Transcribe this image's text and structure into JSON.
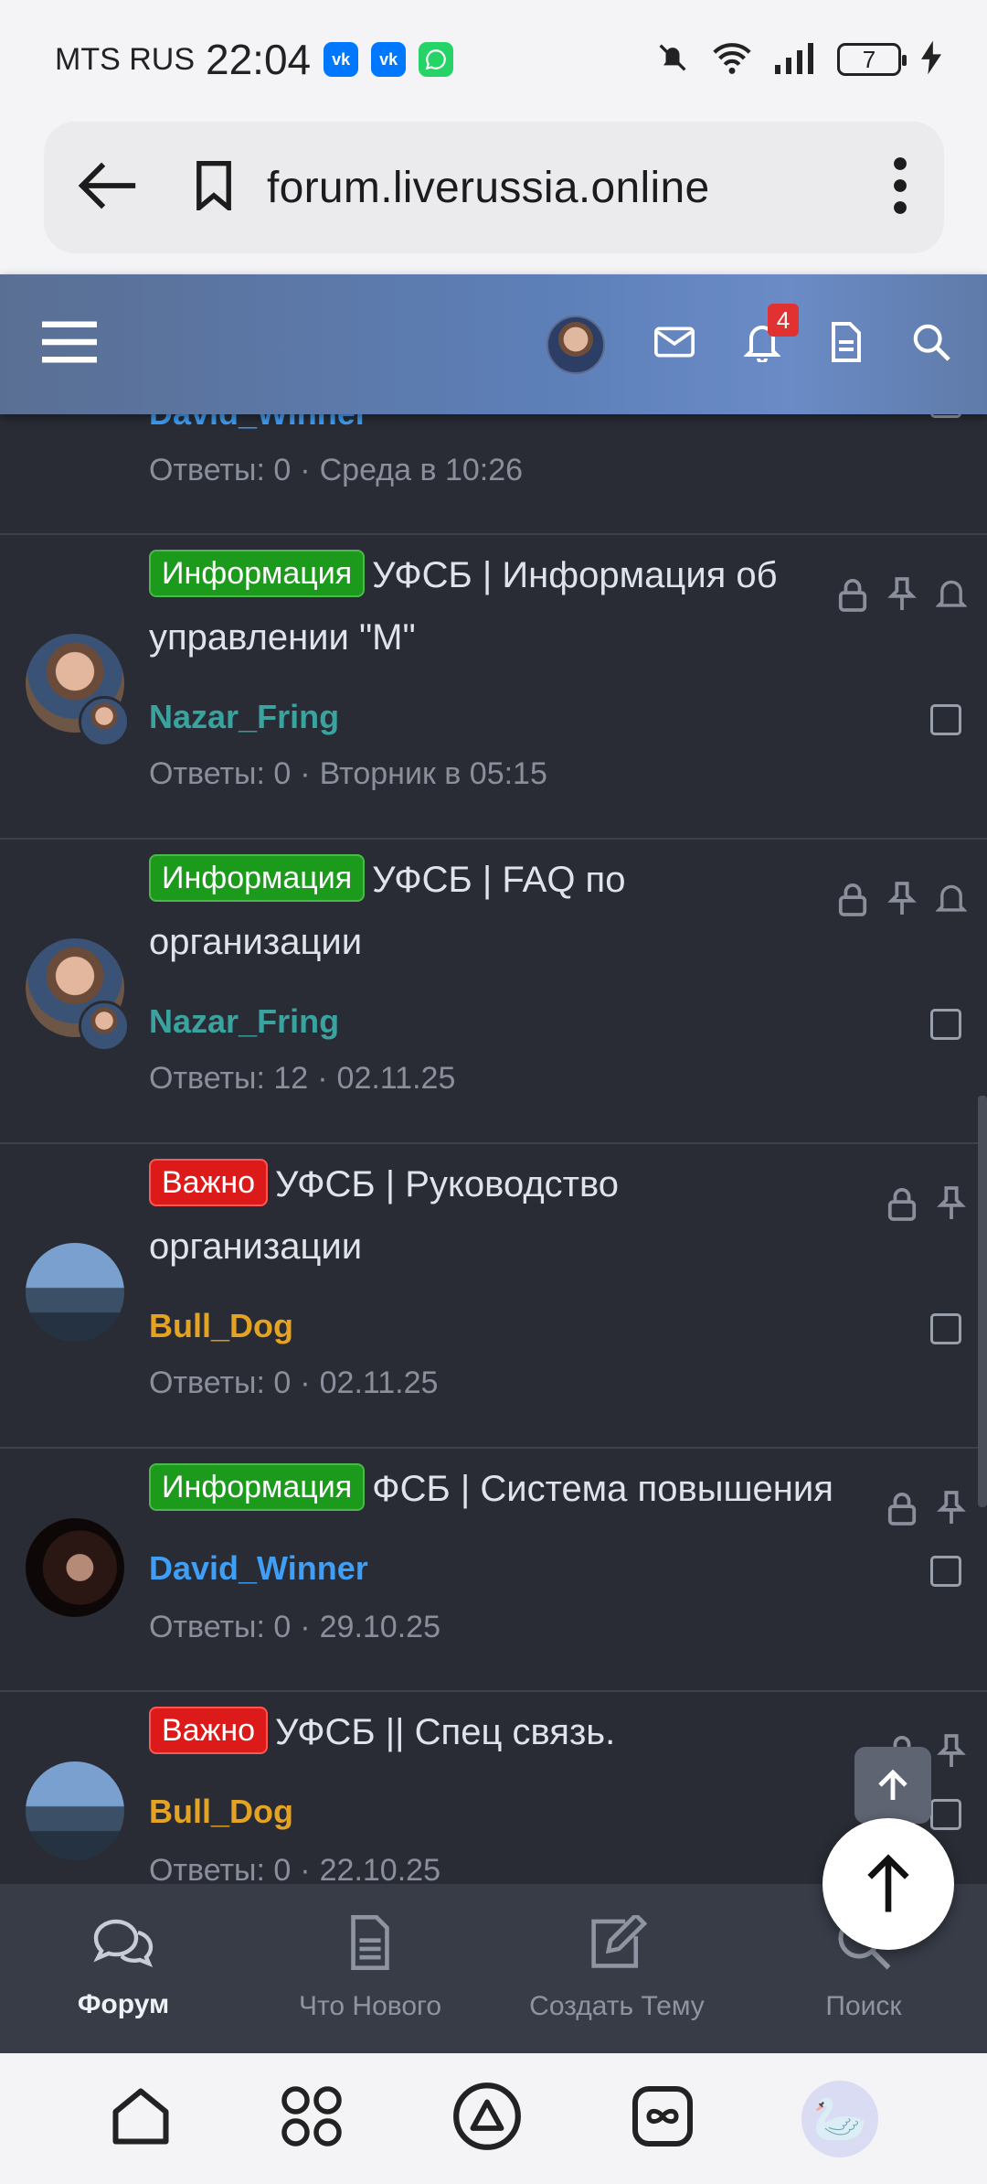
{
  "status_bar": {
    "carrier": "MTS RUS",
    "time": "22:04",
    "app_badges": [
      "vk",
      "vk",
      "whatsapp"
    ],
    "battery": "7"
  },
  "browser": {
    "url": "forum.liverussia.online"
  },
  "header": {
    "notifications_count": "4"
  },
  "partial_thread": {
    "author": "David_Winner",
    "replies": "Ответы: 0",
    "date": "Среда в 10:26"
  },
  "threads": [
    {
      "prefix": "Информация",
      "title": "УФСБ | Информация об управлении \"М\"",
      "author": "Nazar_Fring",
      "replies": "Ответы: 0",
      "date": "Вторник в 05:15"
    },
    {
      "prefix": "Информация",
      "title": "УФСБ | FAQ по организации",
      "author": "Nazar_Fring",
      "replies": "Ответы: 12",
      "date": "02.11.25"
    },
    {
      "prefix": "Важно",
      "title": "УФСБ | Руководство организации",
      "author": "Bull_Dog",
      "replies": "Ответы: 0",
      "date": "02.11.25"
    },
    {
      "prefix": "Информация",
      "title": "ФСБ | Система повышения",
      "author": "David_Winner",
      "replies": "Ответы: 0",
      "date": "29.10.25"
    },
    {
      "prefix": "Важно",
      "title": "УФСБ || Спец связь.",
      "author": "Bull_Dog",
      "replies": "Ответы: 0",
      "date": "22.10.25"
    }
  ],
  "bottom_nav": [
    {
      "label": "Форум",
      "icon": "chat-bubbles-icon",
      "active": true
    },
    {
      "label": "Что Нового",
      "icon": "document-icon",
      "active": false
    },
    {
      "label": "Создать Тему",
      "icon": "edit-icon",
      "active": false
    },
    {
      "label": "Поиск",
      "icon": "search-icon",
      "active": false
    }
  ],
  "colors": {
    "background": "#292c35",
    "prefix_info": "#1c9a1c",
    "prefix_important": "#dd1a1a",
    "author_teal": "#3aa3a0",
    "author_gold": "#e5a323",
    "author_blue": "#3f9ef5"
  }
}
